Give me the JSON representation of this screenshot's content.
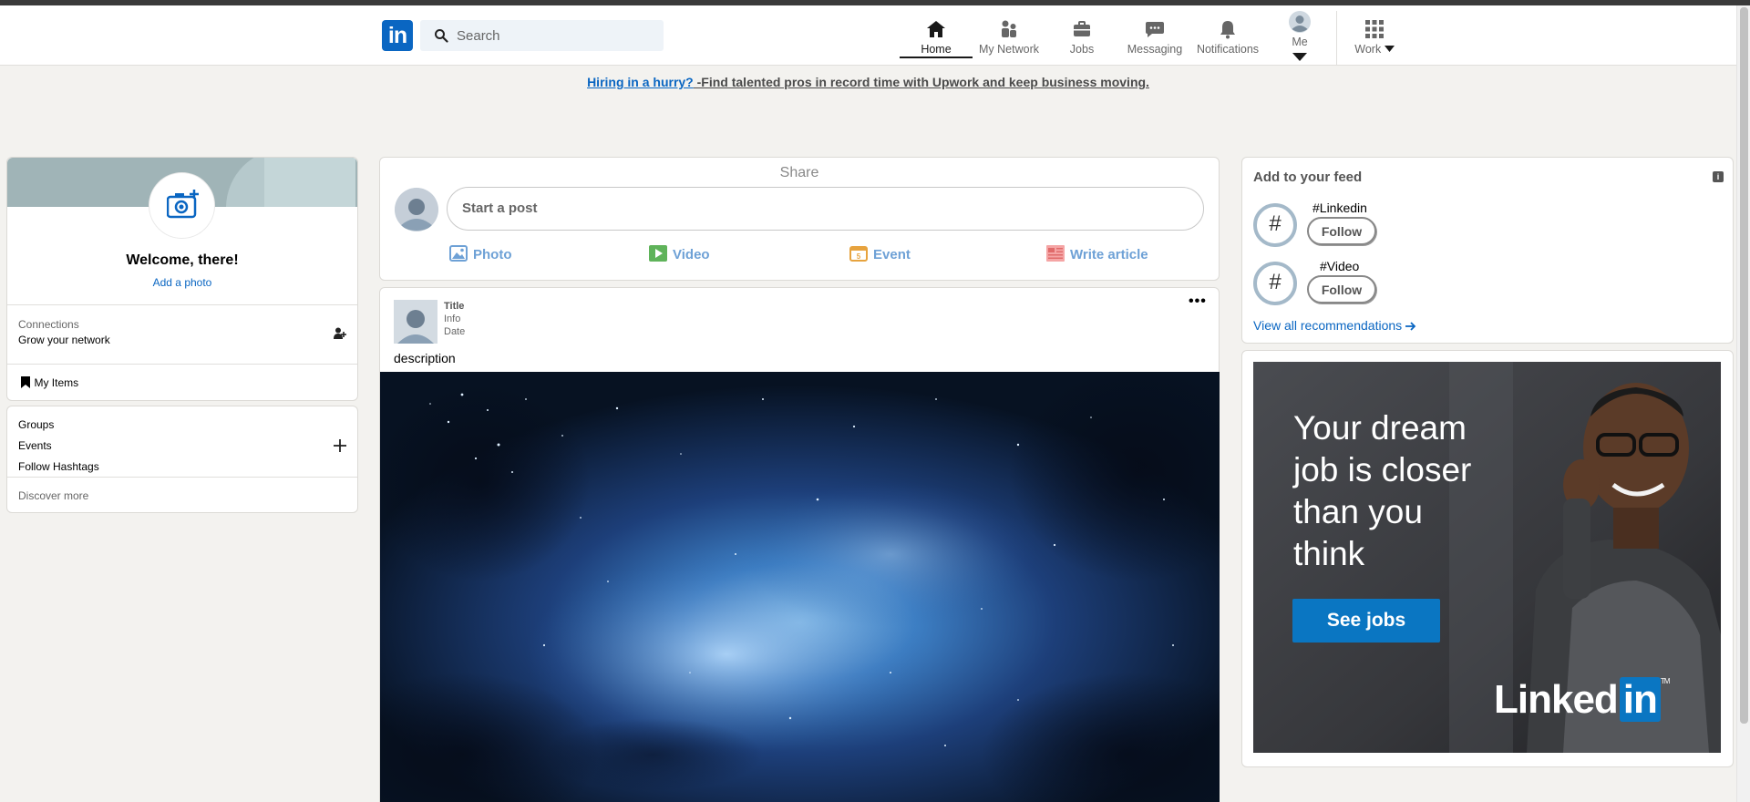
{
  "header": {
    "logo_text": "in",
    "search_placeholder": "Search",
    "nav": [
      {
        "label": "Home",
        "icon": "home-icon"
      },
      {
        "label": "My Network",
        "icon": "people-icon"
      },
      {
        "label": "Jobs",
        "icon": "briefcase-icon"
      },
      {
        "label": "Messaging",
        "icon": "chat-icon"
      },
      {
        "label": "Notifications",
        "icon": "bell-icon"
      },
      {
        "label": "Me",
        "icon": "avatar-icon"
      },
      {
        "label": "Work",
        "icon": "grid-icon"
      }
    ]
  },
  "banner": {
    "link": "Hiring in a hurry?",
    "text": " -Find talented pros in record time with Upwork and keep business moving."
  },
  "profile": {
    "welcome": "Welcome, there!",
    "add_photo": "Add a photo",
    "connections_label": "Connections",
    "connections_sub": "Grow your network",
    "my_items": "My Items",
    "groups": "Groups",
    "events": "Events",
    "follow_hashtags": "Follow Hashtags",
    "discover_more": "Discover more"
  },
  "share": {
    "title": "Share",
    "start_post": "Start a post",
    "actions": [
      "Photo",
      "Video",
      "Event",
      "Write article"
    ]
  },
  "post": {
    "title": "Title",
    "info": "Info",
    "date": "Date",
    "description": "description",
    "more": "•••"
  },
  "feed": {
    "title": "Add to your feed",
    "items": [
      {
        "hashtag": "#Linkedin",
        "button": "Follow"
      },
      {
        "hashtag": "#Video",
        "button": "Follow"
      }
    ],
    "view_all": "View all recommendations"
  },
  "ad": {
    "line1": "Your dream",
    "line2": "job is closer",
    "line3": "than you",
    "line4": "think",
    "button": "See jobs",
    "logo_text": "Linked",
    "logo_in": "in",
    "logo_tm": "TM"
  },
  "colors": {
    "brand": "#0a66c2",
    "background": "#f3f2ef"
  }
}
